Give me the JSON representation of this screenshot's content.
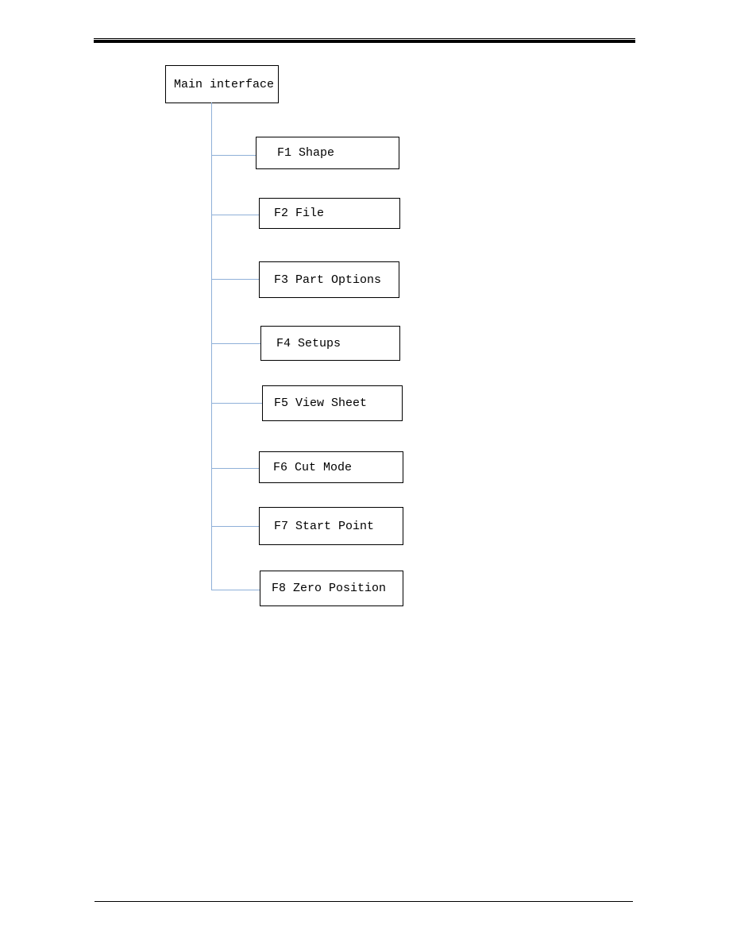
{
  "diagram": {
    "root": {
      "label": "Main interface"
    },
    "children": [
      {
        "label": "F1 Shape"
      },
      {
        "label": "F2 File"
      },
      {
        "label": "F3 Part Options"
      },
      {
        "label": "F4 Setups"
      },
      {
        "label": "F5 View Sheet"
      },
      {
        "label": "F6 Cut Mode"
      },
      {
        "label": "F7 Start Point"
      },
      {
        "label": "F8 Zero Position"
      }
    ],
    "connector_color": "#8fb0d8"
  }
}
